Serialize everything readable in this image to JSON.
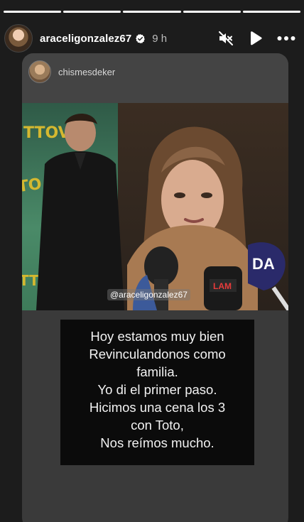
{
  "progress": {
    "segments": [
      1,
      1,
      1,
      1,
      1
    ]
  },
  "header": {
    "username": "araceligonzalez67",
    "time": "9 h",
    "verified": true,
    "icons": [
      "mute-icon",
      "play-icon",
      "more-icon"
    ]
  },
  "card": {
    "source_username": "chismesdeker",
    "video": {
      "watermark": "@araceligonzalez67",
      "mic_labels": [
        "DA",
        "LAM"
      ]
    },
    "text_lines": [
      "Hoy estamos muy bien",
      "Revinculandonos como",
      "familia.",
      "Yo di el primer paso.",
      "Hicimos una cena los 3",
      "con Toto,",
      "Nos reímos mucho."
    ]
  }
}
